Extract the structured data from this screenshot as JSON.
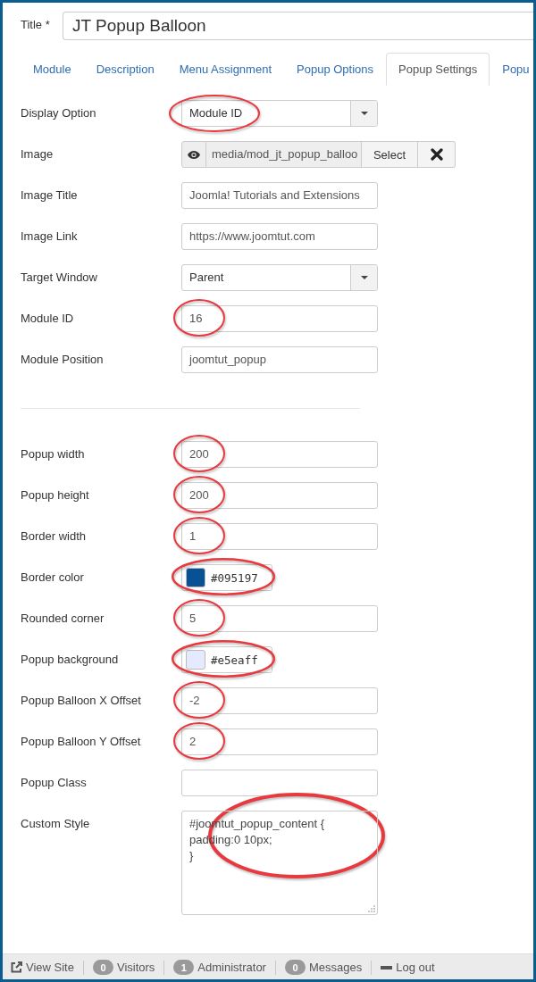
{
  "title_field": {
    "label": "Title *",
    "value": "JT Popup Balloon"
  },
  "tabs": [
    {
      "label": "Module",
      "selected": false
    },
    {
      "label": "Description",
      "selected": false
    },
    {
      "label": "Menu Assignment",
      "selected": false
    },
    {
      "label": "Popup Options",
      "selected": false
    },
    {
      "label": "Popup Settings",
      "selected": true
    },
    {
      "label": "Popu",
      "selected": false
    }
  ],
  "sections": [
    {
      "fields": [
        {
          "kind": "select",
          "label": "Display Option",
          "value": "Module ID",
          "circled": true
        },
        {
          "kind": "media",
          "label": "Image",
          "value": "media/mod_jt_popup_balloo",
          "button": "Select",
          "circled": false
        },
        {
          "kind": "text",
          "label": "Image Title",
          "value": "Joomla! Tutorials and Extensions",
          "circled": false
        },
        {
          "kind": "text",
          "label": "Image Link",
          "value": "https://www.joomtut.com",
          "circled": false
        },
        {
          "kind": "select",
          "label": "Target Window",
          "value": "Parent",
          "circled": false
        },
        {
          "kind": "text",
          "label": "Module ID",
          "value": "16",
          "circled": true
        },
        {
          "kind": "text",
          "label": "Module Position",
          "value": "joomtut_popup",
          "circled": false
        }
      ]
    },
    {
      "fields": [
        {
          "kind": "text",
          "label": "Popup width",
          "value": "200",
          "circled": true
        },
        {
          "kind": "text",
          "label": "Popup height",
          "value": "200",
          "circled": true
        },
        {
          "kind": "text",
          "label": "Border width",
          "value": "1",
          "circled": true
        },
        {
          "kind": "color",
          "label": "Border color",
          "value": "#095197",
          "color": "#095197",
          "circled": true
        },
        {
          "kind": "text",
          "label": "Rounded corner",
          "value": "5",
          "circled": true
        },
        {
          "kind": "color",
          "label": "Popup background",
          "value": "#e5eaff",
          "color": "#e5eaff",
          "circled": true
        },
        {
          "kind": "text",
          "label": "Popup Balloon X Offset",
          "value": "-2",
          "circled": true
        },
        {
          "kind": "text",
          "label": "Popup Balloon Y Offset",
          "value": "2",
          "circled": true
        },
        {
          "kind": "text",
          "label": "Popup Class",
          "circled": false
        },
        {
          "kind": "textarea",
          "label": "Custom Style",
          "value": "#joomtut_popup_content {\npadding:0 10px;\n}",
          "circled": true
        }
      ]
    }
  ],
  "status_bar": [
    {
      "kind": "link",
      "label": "View Site"
    },
    {
      "kind": "count",
      "count": "0",
      "label": "Visitors"
    },
    {
      "kind": "count",
      "count": "1",
      "label": "Administrator"
    },
    {
      "kind": "count",
      "count": "0",
      "label": "Messages"
    },
    {
      "kind": "logout",
      "label": "Log out"
    }
  ]
}
